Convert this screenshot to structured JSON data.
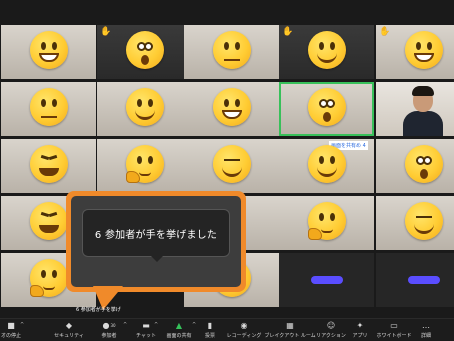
{
  "toast": {
    "text": "6 参加者が手を挙げました"
  },
  "mini_notice": "6 参加者が手を挙げ",
  "grid_name_tags": {
    "row3_col4": "画面を共有め 4"
  },
  "toolbar": {
    "items": [
      {
        "icon": "video-icon",
        "label": "オの停止"
      },
      {
        "icon": "shield-icon",
        "label": "セキュリティ"
      },
      {
        "icon": "participants-icon",
        "label": "参加者",
        "count": "30"
      },
      {
        "icon": "chat-icon",
        "label": "チャット"
      },
      {
        "icon": "share-screen-icon",
        "label": "画面の共有"
      },
      {
        "icon": "poll-icon",
        "label": "投票"
      },
      {
        "icon": "record-icon",
        "label": "レコーディング"
      },
      {
        "icon": "breakout-icon",
        "label": "ブレイクアウト ルーム"
      },
      {
        "icon": "reaction-icon",
        "label": "リアクション"
      },
      {
        "icon": "apps-icon",
        "label": "アプリ"
      },
      {
        "icon": "whiteboard-icon",
        "label": "ホワイトボード"
      },
      {
        "icon": "more-icon",
        "label": "詳細"
      }
    ]
  },
  "colors": {
    "accent": "#f08a2a",
    "share_green": "#35c15a",
    "pill_blue": "#5a4dff",
    "emoji_yellow": "#ffcc33"
  }
}
